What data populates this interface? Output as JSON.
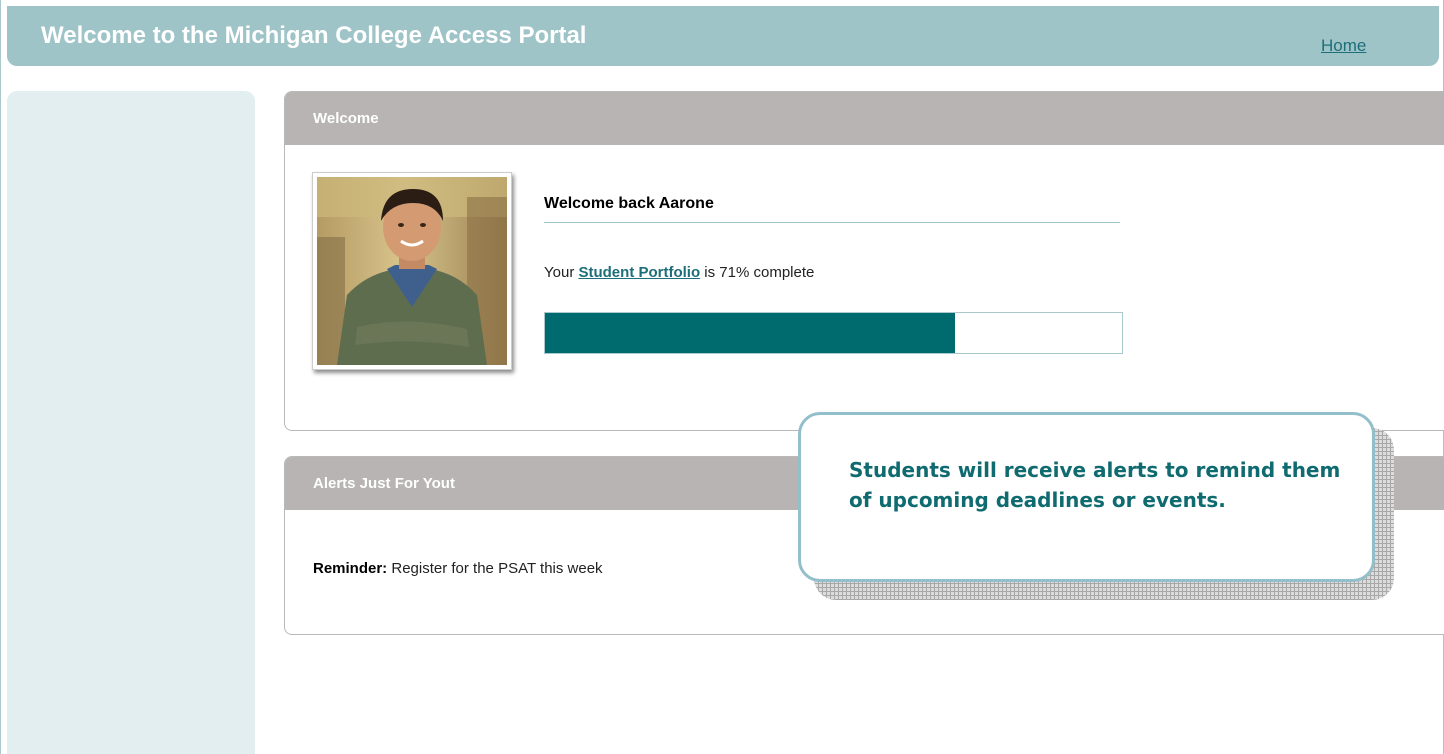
{
  "header": {
    "title": "Welcome to the Michigan College Access Portal",
    "home_link": "Home"
  },
  "welcome_panel": {
    "title": "Welcome",
    "greeting": "Welcome back Aarone",
    "portfolio_prefix": "Your ",
    "portfolio_link": "Student Portfolio",
    "portfolio_suffix": " is 71% complete",
    "progress_percent": 71
  },
  "alerts_panel": {
    "title": "Alerts Just For Yout",
    "reminder_label": "Reminder:",
    "reminder_text": " Register for the PSAT this week"
  },
  "callout": {
    "text": "Students will receive alerts to remind them of upcoming deadlines or events."
  },
  "colors": {
    "header_bg": "#9ec4c8",
    "panel_header_bg": "#b7b4b3",
    "progress_fill": "#006b6f",
    "link": "#1e6e7a",
    "callout_text": "#0f6b6f"
  }
}
